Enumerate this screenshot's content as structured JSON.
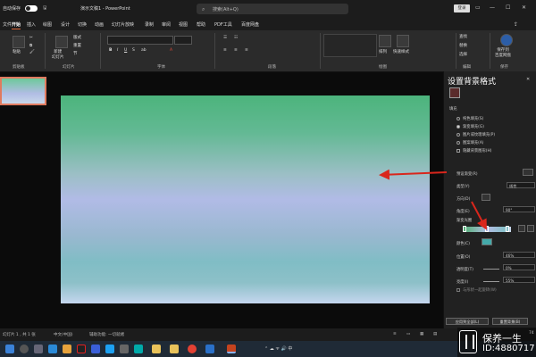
{
  "titlebar": {
    "autosave_label": "自动保存",
    "doc_title": "演示文稿1 - PowerPoint",
    "search_placeholder": "搜索(Alt+Q)",
    "login_label": "登录"
  },
  "tabs": [
    "文件",
    "开始",
    "插入",
    "绘图",
    "设计",
    "切换",
    "动画",
    "幻灯片放映",
    "录制",
    "审阅",
    "视图",
    "帮助",
    "PDF工具",
    "百度网盘"
  ],
  "active_tab": "开始",
  "ribbon": {
    "groups": [
      "剪贴板",
      "幻灯片",
      "字体",
      "段落",
      "绘图",
      "编辑",
      "保存"
    ],
    "paste_label": "粘贴",
    "new_slide_label": "新建\n幻灯片",
    "layout_label": "版式",
    "reset_label": "重置",
    "section_label": "节",
    "arrange_label": "排列",
    "quick_styles_label": "快速样式",
    "find_label": "查找",
    "replace_label": "替换",
    "select_label": "选择",
    "baidu_save_label": "保存到\n百度网盘"
  },
  "pane": {
    "title": "设置背景格式",
    "section_fill": "填充",
    "options": [
      "纯色填充(S)",
      "渐变填充(G)",
      "图片或纹理填充(P)",
      "图案填充(A)"
    ],
    "selected_option": "渐变填充(G)",
    "hide_bg_label": "隐藏背景图形(H)",
    "preset_label": "预设渐变(R)",
    "type_label": "类型(Y)",
    "type_value": "线性",
    "direction_label": "方向(D)",
    "angle_label": "角度(E)",
    "angle_value": "90°",
    "stops_label": "渐变光圈",
    "color_label": "颜色(C)",
    "position_label": "位置(O)",
    "position_value": "46%",
    "transparency_label": "透明度(T)",
    "transparency_value": "0%",
    "brightness_label": "亮度(I)",
    "brightness_value": "55%",
    "rotate_label": "与形状一起旋转(W)",
    "apply_all_label": "应用到全部(L)",
    "reset_bg_label": "重置背景(B)"
  },
  "status": {
    "slide_info": "幻灯片 1 , 共 1 张",
    "language": "中文(中国)",
    "accessibility": "辅助功能: 一切就绪",
    "zoom": "74"
  },
  "watermark": {
    "line1": "保养一生",
    "line2": "ID:4880717"
  },
  "colors": {
    "accent": "#e06a3b",
    "arrow_red": "#d9261c"
  }
}
